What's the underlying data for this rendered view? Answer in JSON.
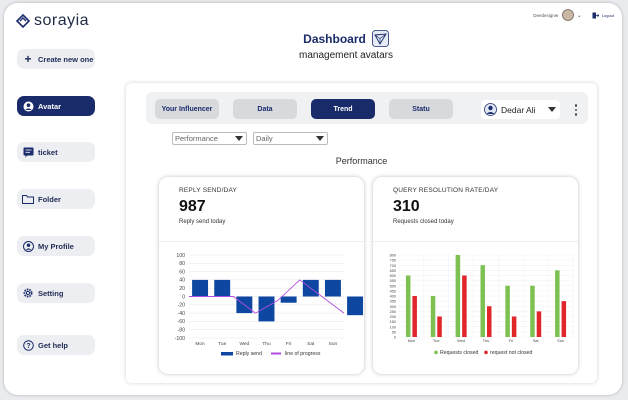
{
  "brand": {
    "name": "sorayia"
  },
  "sidebar": {
    "items": [
      {
        "label": "Create new one",
        "icon": "plus-icon"
      },
      {
        "label": "Avatar",
        "icon": "user-circle-icon"
      },
      {
        "label": "ticket",
        "icon": "message-icon"
      },
      {
        "label": "Folder",
        "icon": "folder-icon"
      },
      {
        "label": "My Profile",
        "icon": "user-circle-icon"
      },
      {
        "label": "Setting",
        "icon": "gear-icon"
      },
      {
        "label": "Get help",
        "icon": "help-icon"
      }
    ]
  },
  "topbar": {
    "username": "Deedesigner",
    "logout": "Logout"
  },
  "header": {
    "title": "Dashboard",
    "subtitle": "management avatars"
  },
  "tabs": [
    {
      "label": "Your Influencer"
    },
    {
      "label": "Data"
    },
    {
      "label": "Trend"
    },
    {
      "label": "Statu"
    }
  ],
  "user_select": {
    "value": "Dedar Ali"
  },
  "filters": {
    "metric": "Performance",
    "period": "Daily"
  },
  "section_label": "Performance",
  "colors": {
    "accent": "#1a2b6b",
    "bar_blue": "#0d47a1",
    "line_purple": "#b04ce0",
    "green": "#7cc152",
    "red": "#e0262b"
  },
  "cards": {
    "reply": {
      "title": "REPLY SEND/DAY",
      "value": "987",
      "subtitle": "Reply send today"
    },
    "query": {
      "title": "QUERY RESOLUTION RATE/DAY",
      "value": "310",
      "subtitle": "Requests closed today"
    }
  },
  "chart_data": [
    {
      "type": "bar",
      "categories": [
        "Mon",
        "Tue",
        "Wed",
        "Thu",
        "Fri",
        "Sat",
        "Sun"
      ],
      "series": [
        {
          "name": "Reply send",
          "type": "bar",
          "values": [
            0,
            0,
            -40,
            -60,
            -15,
            40,
            0,
            -45
          ]
        },
        {
          "name": "line of progress",
          "type": "line",
          "values": [
            0,
            0,
            0,
            -40,
            -10,
            40,
            0,
            -40
          ]
        }
      ],
      "bar_values": [
        0,
        0,
        -40,
        -60,
        -15,
        40,
        0,
        -45
      ],
      "y_ticks": [
        "100",
        "80",
        "60",
        "40",
        "20",
        "0",
        "-20",
        "-40",
        "-60",
        "-80",
        "-100"
      ],
      "ylim": [
        -100,
        100
      ],
      "legend_position": "bottom"
    },
    {
      "type": "bar",
      "categories": [
        "Mon",
        "Tue",
        "Wed",
        "Thu",
        "Fri",
        "Sat",
        "Sun"
      ],
      "series": [
        {
          "name": "Requests closed",
          "values": [
            600,
            400,
            800,
            700,
            500,
            500,
            650
          ]
        },
        {
          "name": "request not closed",
          "values": [
            400,
            200,
            600,
            300,
            200,
            250,
            350
          ]
        }
      ],
      "y_ticks": [
        "800",
        "750",
        "700",
        "650",
        "600",
        "550",
        "500",
        "450",
        "400",
        "350",
        "300",
        "250",
        "200",
        "150",
        "100",
        "50",
        "0"
      ],
      "ylim": [
        0,
        800
      ],
      "legend_position": "bottom"
    }
  ]
}
